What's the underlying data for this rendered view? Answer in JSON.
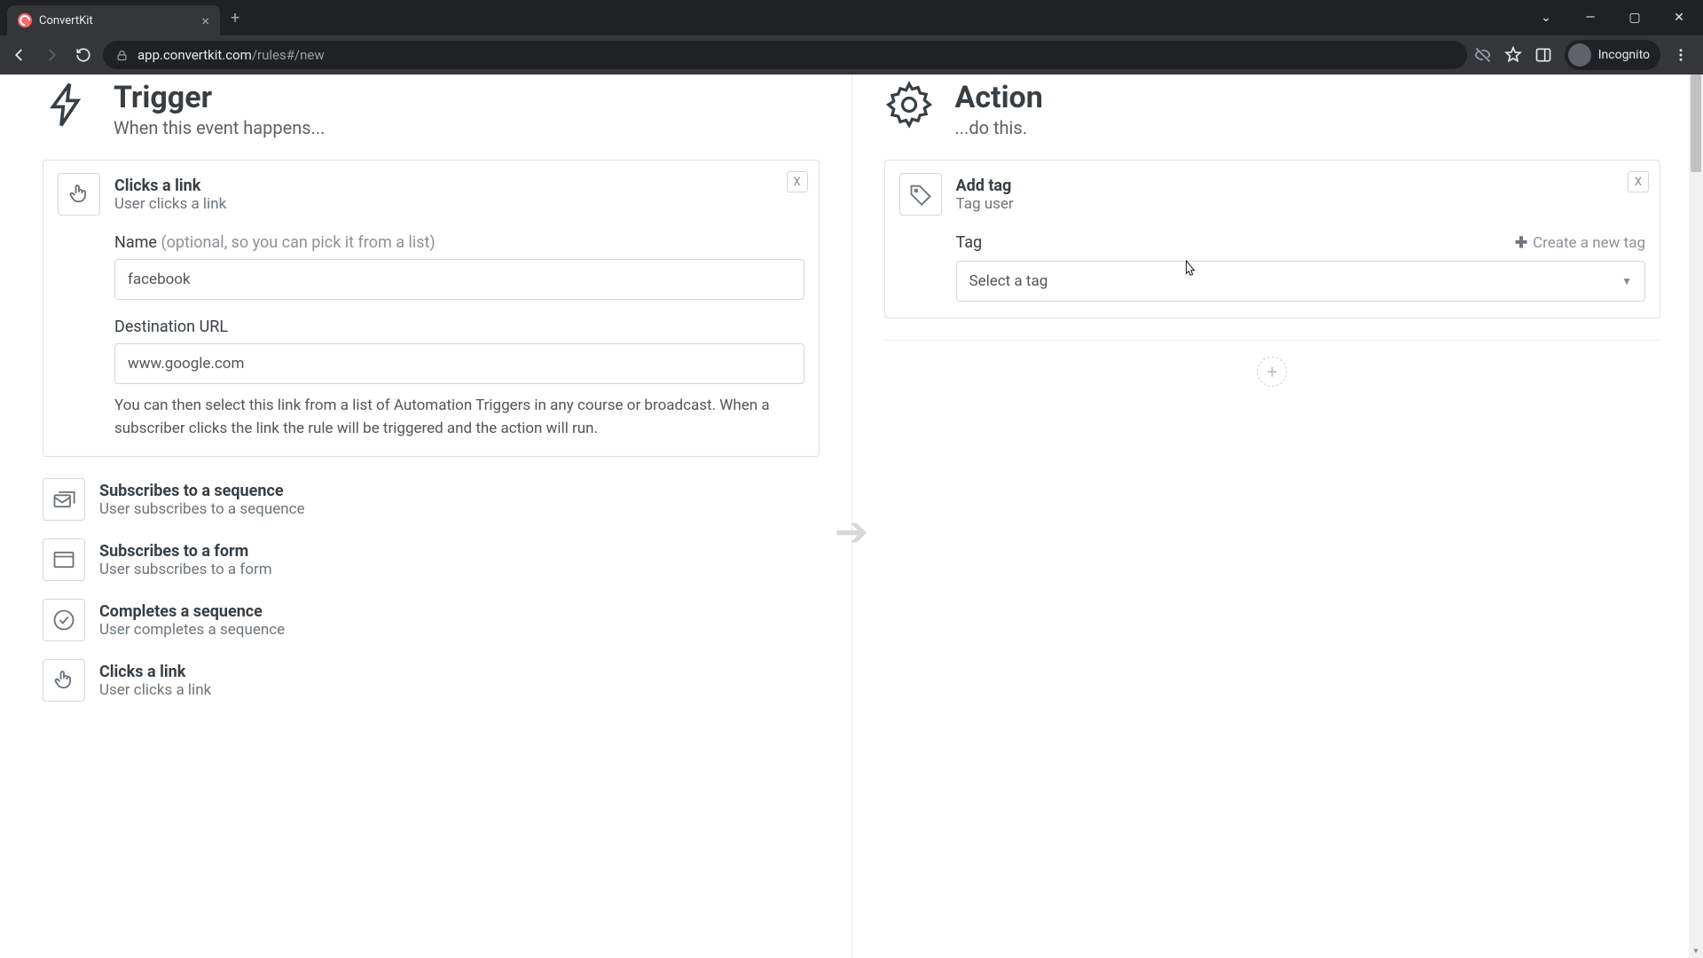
{
  "browser": {
    "tab_title": "ConvertKit",
    "url_prefix": "app.convertkit.com",
    "url_path": "/rules#/new",
    "incognito_label": "Incognito"
  },
  "trigger": {
    "heading": "Trigger",
    "subheading": "When this event happens...",
    "selected": {
      "title": "Clicks a link",
      "subtitle": "User clicks a link",
      "close": "X",
      "name_label": "Name",
      "name_hint": "(optional, so you can pick it from a list)",
      "name_value": "facebook",
      "url_label": "Destination URL",
      "url_value": "www.google.com",
      "help": "You can then select this link from a list of Automation Triggers in any course or broadcast. When a subscriber clicks the link the rule will be triggered and the action will run."
    },
    "options": [
      {
        "title": "Subscribes to a sequence",
        "subtitle": "User subscribes to a sequence"
      },
      {
        "title": "Subscribes to a form",
        "subtitle": "User subscribes to a form"
      },
      {
        "title": "Completes a sequence",
        "subtitle": "User completes a sequence"
      },
      {
        "title": "Clicks a link",
        "subtitle": "User clicks a link"
      }
    ]
  },
  "action": {
    "heading": "Action",
    "subheading": "...do this.",
    "selected": {
      "title": "Add tag",
      "subtitle": "Tag user",
      "close": "X",
      "tag_label": "Tag",
      "create_link": "Create a new tag",
      "select_placeholder": "Select a tag"
    }
  }
}
